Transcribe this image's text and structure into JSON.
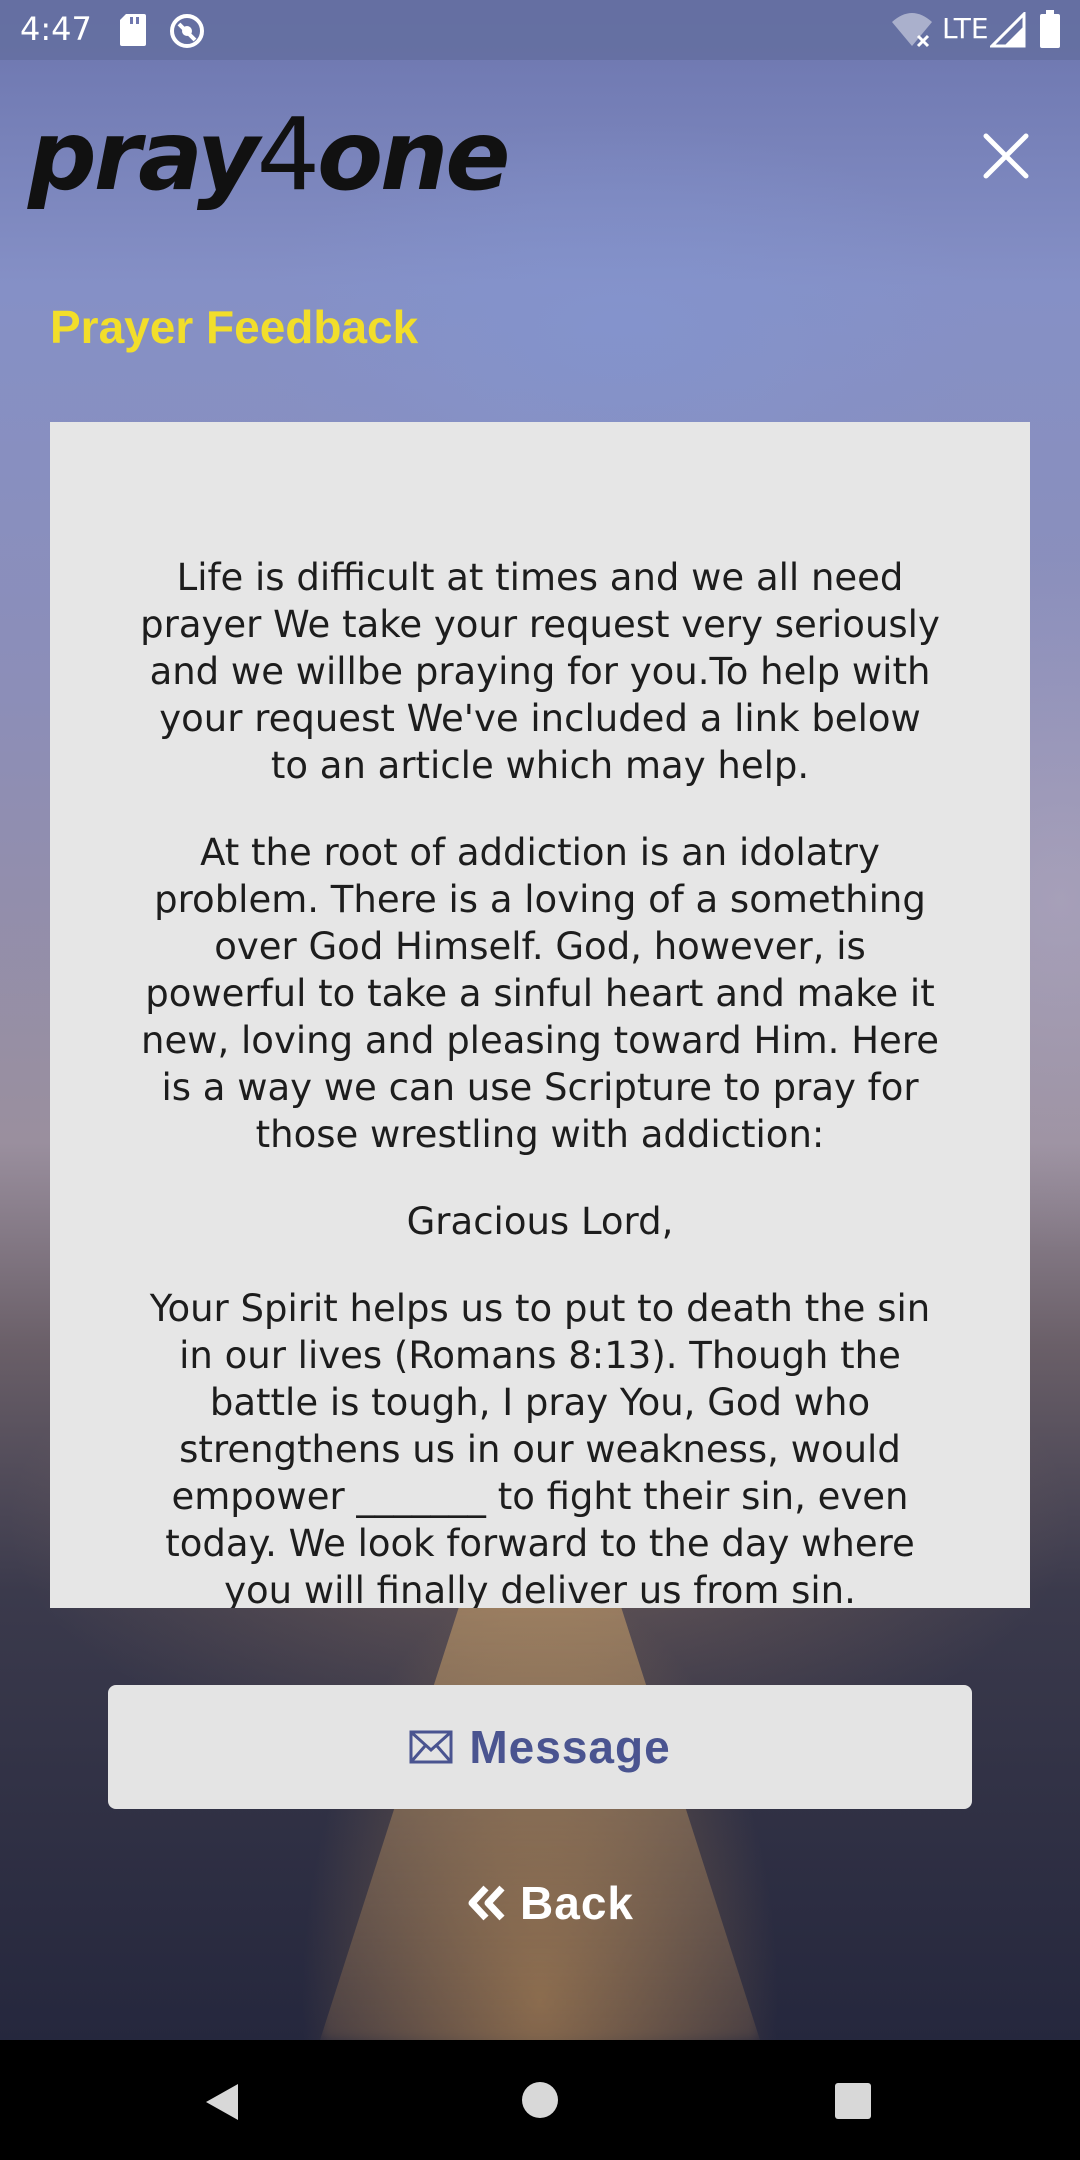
{
  "status_bar": {
    "time": "4:47",
    "network": "LTE",
    "icons": [
      "sd-card-icon",
      "sync-icon",
      "wifi-off-icon",
      "signal-icon",
      "battery-icon"
    ]
  },
  "header": {
    "logo_part1": "pray",
    "logo_part2": "4",
    "logo_part3": "one",
    "close_icon": "close-icon"
  },
  "page": {
    "title": "Prayer Feedback",
    "paragraphs": [
      "Life is difficult at times and we all need prayer We take your request very seriously and we willbe praying for you.To help with your request We've included a link below to an article which may help.",
      "At the root of addiction is an idolatry problem. There is a loving of a something over God Himself. God, however, is powerful to take a sinful heart and make it new, loving and pleasing toward Him. Here is a way we can use Scripture to pray for those wrestling with addiction:",
      "Gracious Lord,",
      "Your Spirit helps us to put to death the sin in our lives (Romans 8:13). Though the battle is tough, I pray You, God who strengthens us in our weakness, would empower _______ to fight their sin, even today. We look forward to the day where you will finally deliver us from sin."
    ]
  },
  "actions": {
    "message_label": "Message",
    "message_icon": "envelope-icon",
    "back_label": "Back",
    "back_icon": "double-chevron-left-icon"
  },
  "colors": {
    "title": "#f2de2a",
    "card_bg": "#e6e6e6",
    "message_text": "#4a5490",
    "back_text": "#ffffff"
  },
  "nav_bar": {
    "icons": [
      "nav-back-icon",
      "nav-home-icon",
      "nav-recents-icon"
    ]
  }
}
